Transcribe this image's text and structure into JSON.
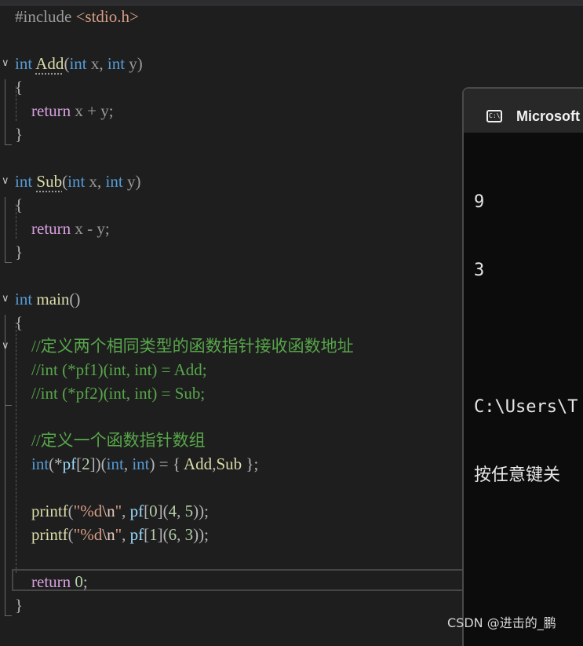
{
  "editor": {
    "lines": [
      [
        {
          "t": "#include ",
          "c": "pre"
        },
        {
          "t": "<stdio.h>",
          "c": "inc"
        }
      ],
      [],
      [
        {
          "t": "int",
          "c": "kw"
        },
        {
          "t": " ",
          "c": ""
        },
        {
          "t": "Add",
          "c": "fn-u"
        },
        {
          "t": "(",
          "c": "op"
        },
        {
          "t": "int",
          "c": "kw"
        },
        {
          "t": " x, ",
          "c": "param"
        },
        {
          "t": "int",
          "c": "kw"
        },
        {
          "t": " y)",
          "c": "param"
        }
      ],
      [
        {
          "t": "{",
          "c": "op"
        }
      ],
      [
        {
          "t": "    ",
          "c": ""
        },
        {
          "t": "return",
          "c": "ctl"
        },
        {
          "t": " x + y;",
          "c": "param"
        }
      ],
      [
        {
          "t": "}",
          "c": "op"
        }
      ],
      [],
      [
        {
          "t": "int",
          "c": "kw"
        },
        {
          "t": " ",
          "c": ""
        },
        {
          "t": "Sub",
          "c": "fn-u"
        },
        {
          "t": "(",
          "c": "op"
        },
        {
          "t": "int",
          "c": "kw"
        },
        {
          "t": " x, ",
          "c": "param"
        },
        {
          "t": "int",
          "c": "kw"
        },
        {
          "t": " y)",
          "c": "param"
        }
      ],
      [
        {
          "t": "{",
          "c": "op"
        }
      ],
      [
        {
          "t": "    ",
          "c": ""
        },
        {
          "t": "return",
          "c": "ctl"
        },
        {
          "t": " x - y;",
          "c": "param"
        }
      ],
      [
        {
          "t": "}",
          "c": "op"
        }
      ],
      [],
      [
        {
          "t": "int",
          "c": "kw"
        },
        {
          "t": " ",
          "c": ""
        },
        {
          "t": "main",
          "c": "fn"
        },
        {
          "t": "()",
          "c": "op"
        }
      ],
      [
        {
          "t": "{",
          "c": "op"
        }
      ],
      [
        {
          "t": "    ",
          "c": ""
        },
        {
          "t": "//定义两个相同类型的函数指针接收函数地址",
          "c": "cmt"
        }
      ],
      [
        {
          "t": "    ",
          "c": ""
        },
        {
          "t": "//int (*pf1)(int, int) = Add;",
          "c": "cmt"
        }
      ],
      [
        {
          "t": "    ",
          "c": ""
        },
        {
          "t": "//int (*pf2)(int, int) = Sub;",
          "c": "cmt"
        }
      ],
      [],
      [
        {
          "t": "    ",
          "c": ""
        },
        {
          "t": "//定义一个函数指针数组",
          "c": "cmt"
        }
      ],
      [
        {
          "t": "    ",
          "c": ""
        },
        {
          "t": "int",
          "c": "kw"
        },
        {
          "t": "(*",
          "c": "op"
        },
        {
          "t": "pf",
          "c": "var"
        },
        {
          "t": "[",
          "c": "op"
        },
        {
          "t": "2",
          "c": "num"
        },
        {
          "t": "])(",
          "c": "op"
        },
        {
          "t": "int",
          "c": "kw"
        },
        {
          "t": ", ",
          "c": "op"
        },
        {
          "t": "int",
          "c": "kw"
        },
        {
          "t": ") = { ",
          "c": "op"
        },
        {
          "t": "Add",
          "c": "fn"
        },
        {
          "t": ",",
          "c": "op"
        },
        {
          "t": "Sub",
          "c": "fn"
        },
        {
          "t": " };",
          "c": "op"
        }
      ],
      [],
      [
        {
          "t": "    ",
          "c": ""
        },
        {
          "t": "printf",
          "c": "fn"
        },
        {
          "t": "(",
          "c": "op"
        },
        {
          "t": "\"%d",
          "c": "str"
        },
        {
          "t": "\\n",
          "c": "esc"
        },
        {
          "t": "\"",
          "c": "str"
        },
        {
          "t": ", ",
          "c": "op"
        },
        {
          "t": "pf",
          "c": "var"
        },
        {
          "t": "[",
          "c": "op"
        },
        {
          "t": "0",
          "c": "num"
        },
        {
          "t": "](",
          "c": "op"
        },
        {
          "t": "4",
          "c": "num"
        },
        {
          "t": ", ",
          "c": "op"
        },
        {
          "t": "5",
          "c": "num"
        },
        {
          "t": "));",
          "c": "op"
        }
      ],
      [
        {
          "t": "    ",
          "c": ""
        },
        {
          "t": "printf",
          "c": "fn"
        },
        {
          "t": "(",
          "c": "op"
        },
        {
          "t": "\"%d",
          "c": "str"
        },
        {
          "t": "\\n",
          "c": "esc"
        },
        {
          "t": "\"",
          "c": "str"
        },
        {
          "t": ", ",
          "c": "op"
        },
        {
          "t": "pf",
          "c": "var"
        },
        {
          "t": "[",
          "c": "op"
        },
        {
          "t": "1",
          "c": "num"
        },
        {
          "t": "](",
          "c": "op"
        },
        {
          "t": "6",
          "c": "num"
        },
        {
          "t": ", ",
          "c": "op"
        },
        {
          "t": "3",
          "c": "num"
        },
        {
          "t": "));",
          "c": "op"
        }
      ],
      [],
      [
        {
          "t": "    ",
          "c": ""
        },
        {
          "t": "return",
          "c": "ctl"
        },
        {
          "t": " ",
          "c": ""
        },
        {
          "t": "0",
          "c": "num"
        },
        {
          "t": ";",
          "c": "op"
        }
      ],
      [
        {
          "t": "}",
          "c": "op"
        }
      ]
    ],
    "colors": {
      "keyword": "#569cd6",
      "control": "#d8a0df",
      "function": "#dcdcaa",
      "comment": "#57a64a",
      "string": "#d69d85",
      "number": "#b5cea8",
      "variable": "#9cdcfe",
      "background": "#1e1e1e"
    }
  },
  "console": {
    "icon": "console-icon",
    "icon_text": "C:\\",
    "title": "Microsoft",
    "output": [
      "9",
      "3",
      "",
      "C:\\Users\\T",
      "按任意键关"
    ]
  },
  "watermark": "CSDN @进击的_鹏"
}
